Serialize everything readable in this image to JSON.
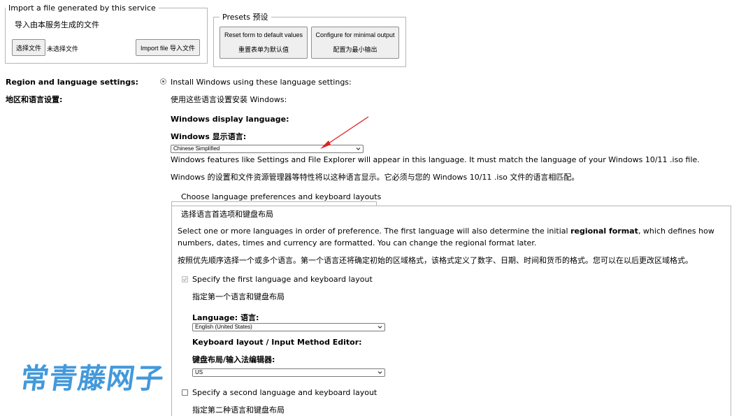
{
  "import_section": {
    "legend": "Import a file generated by this service",
    "subtitle": "导入由本服务生成的文件",
    "choose_file_button": "选择文件",
    "no_file_text": "未选择文件",
    "import_button": "Import file  导入文件"
  },
  "presets_section": {
    "legend": "Presets  预设",
    "reset_button_en": "Reset form to default values",
    "reset_button_zh": "重置表单为默认值",
    "minimal_button_en": "Configure for minimal output",
    "minimal_button_zh": "配置为最小输出"
  },
  "region": {
    "label_en": "Region and language settings:",
    "label_zh": "地区和语言设置:",
    "radio_label_en": "Install Windows using these language settings:",
    "radio_label_zh": "使用这些语言设置安装 Windows:",
    "display_lang_label_en": "Windows display language:",
    "display_lang_label_zh": "Windows 显示语言:",
    "display_lang_value": "Chinese Simplified",
    "display_lang_desc_en": "Windows features like Settings and File Explorer will appear in this language. It must match the language of your Windows 10/11 .iso file.",
    "display_lang_desc_zh": "Windows 的设置和文件资源管理器等特性将以这种语言显示。它必须与您的 Windows 10/11 .iso 文件的语言相匹配。"
  },
  "prefs": {
    "legend_en": "Choose language preferences and keyboard layouts",
    "legend_zh": "选择语言首选项和键盘布局",
    "intro_en_1": "Select one or more languages in order of preference. The first language will also determine the initial ",
    "intro_en_bold": "regional format",
    "intro_en_2": ", which defines how",
    "intro_en_3": "numbers, dates, times and currency are formatted. You can change the regional format later.",
    "intro_zh": "按照优先顺序选择一个或多个语言。第一个语言还将确定初始的区域格式，该格式定义了数字、日期、时间和货币的格式。您可以在以后更改区域格式。",
    "first_check_en": "Specify the first language and keyboard layout",
    "first_check_zh": "指定第一个语言和键盘布局",
    "language_label": "Language:  语言:",
    "language_value": "English (United States)",
    "keyboard_label_en": "Keyboard layout / Input Method Editor:",
    "keyboard_label_zh": "键盘布局/输入法编辑器:",
    "keyboard_value": "US",
    "second_check_en": "Specify a second language and keyboard layout",
    "second_check_zh": "指定第二种语言和键盘布局"
  },
  "watermark": "常青藤网子",
  "colors": {
    "arrow": "#e02020",
    "watermark": "#2f8fd8",
    "border": "#b6b6b6"
  }
}
